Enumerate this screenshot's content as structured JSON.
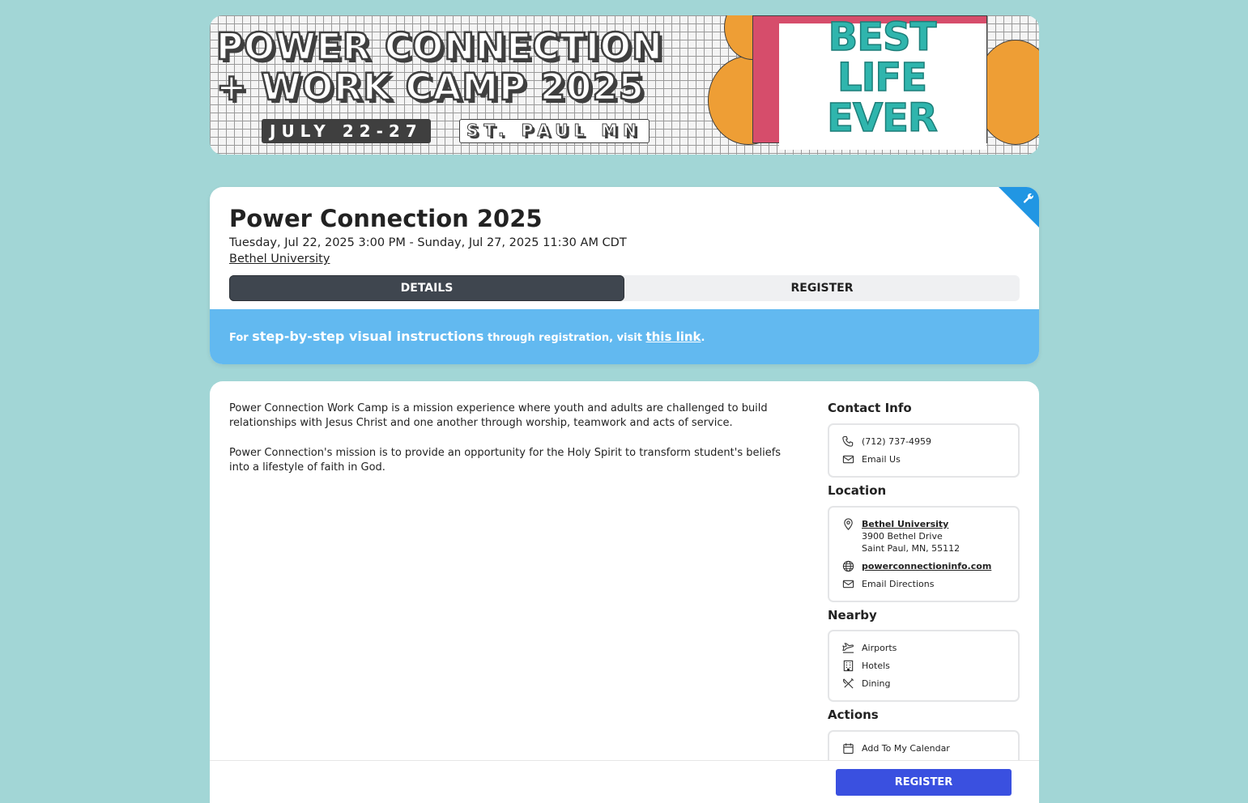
{
  "banner": {
    "title_line1": "POWER CONNECTION",
    "title_line2": "+ WORK CAMP 2025",
    "date": "JULY 22-27",
    "place": "ST. PAUL MN",
    "art_text1": "BEST",
    "art_text2": "LIFE",
    "art_text3": "EVER",
    "colors": {
      "grid_bg": "#f4f4f4",
      "ink": "#3f3f3f",
      "orange": "#ee9e35",
      "pink": "#d64d6b",
      "teal": "#2fb5ad"
    }
  },
  "event": {
    "title": "Power Connection 2025",
    "date_range": "Tuesday, Jul 22, 2025 3:00 PM - Sunday, Jul 27, 2025 11:30 AM CDT",
    "venue": "Bethel University",
    "corner_icon": "wrench-icon"
  },
  "tabs": [
    {
      "label": "DETAILS",
      "active": true
    },
    {
      "label": "REGISTER",
      "active": false
    }
  ],
  "notice": {
    "prefix": "For",
    "highlight": "step-by-step visual instructions",
    "middle": "through registration, visit",
    "link": "this link",
    "suffix": "."
  },
  "description": [
    "Power Connection Work Camp is a mission experience where youth and adults are challenged to build relationships with Jesus Christ and one another through worship, teamwork and acts of service.",
    "Power Connection's mission is to provide an opportunity for the Holy Spirit to transform student's beliefs into a lifestyle of faith in God."
  ],
  "contact": {
    "title": "Contact Info",
    "phone": "(712) 737-4959",
    "email": "Email Us"
  },
  "location": {
    "title": "Location",
    "name": "Bethel University",
    "street": "3900 Bethel Drive",
    "city": "Saint Paul, MN, 55112",
    "website": "powerconnectioninfo.com",
    "directions": "Email Directions"
  },
  "nearby": {
    "title": "Nearby",
    "items": [
      "Airports",
      "Hotels",
      "Dining"
    ]
  },
  "actions": {
    "title": "Actions",
    "items": [
      "Add To My Calendar"
    ]
  },
  "footer": {
    "register_label": "REGISTER"
  },
  "colors": {
    "page_bg": "#a2d6d6",
    "tab_active": "#3f464f",
    "notice_bg": "#62b9f0",
    "corner": "#2196e3",
    "primary_button": "#3a50e0"
  }
}
